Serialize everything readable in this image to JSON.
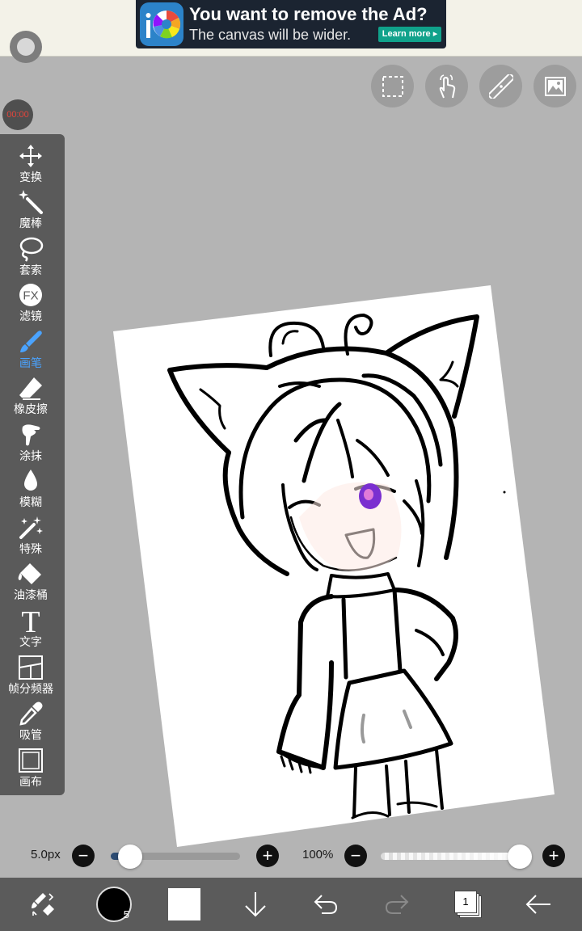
{
  "ad": {
    "title": "You want to remove the Ad?",
    "subtitle": "The canvas will be wider.",
    "button": "Learn more ▸",
    "logo_text": "iP"
  },
  "recording": {
    "timer": "00:00"
  },
  "top_tools": [
    {
      "name": "selection-tool-button",
      "icon": "dashed-rect-icon"
    },
    {
      "name": "gesture-button",
      "icon": "hand-touch-icon"
    },
    {
      "name": "ruler-button",
      "icon": "ruler-icon"
    },
    {
      "name": "reference-image-button",
      "icon": "image-icon"
    }
  ],
  "tools": [
    {
      "label": "变换",
      "icon": "move-arrows-icon"
    },
    {
      "label": "魔棒",
      "icon": "magic-wand-icon"
    },
    {
      "label": "套索",
      "icon": "lasso-icon"
    },
    {
      "label": "滤镜",
      "icon": "fx-icon",
      "icon_text": "FX"
    },
    {
      "label": "画笔",
      "icon": "brush-icon",
      "active": true
    },
    {
      "label": "橡皮擦",
      "icon": "eraser-icon"
    },
    {
      "label": "涂抹",
      "icon": "smudge-icon"
    },
    {
      "label": "模糊",
      "icon": "drop-icon"
    },
    {
      "label": "特殊",
      "icon": "special-brush-icon"
    },
    {
      "label": "油漆桶",
      "icon": "bucket-icon"
    },
    {
      "label": "文字",
      "icon": "text-icon",
      "icon_text": "T"
    },
    {
      "label": "帧分频器",
      "icon": "frame-divider-icon"
    },
    {
      "label": "吸管",
      "icon": "eyedropper-icon"
    },
    {
      "label": "画布",
      "icon": "canvas-icon"
    }
  ],
  "brush": {
    "size_label": "5.0px",
    "size_fraction": 0.05
  },
  "opacity": {
    "label": "100%",
    "fraction": 1.0
  },
  "bottom": {
    "brush_size_badge": "5",
    "layer_count": "1",
    "colors": {
      "primary": "#000000",
      "secondary": "#ffffff",
      "accent": "#4aa3ff"
    }
  }
}
